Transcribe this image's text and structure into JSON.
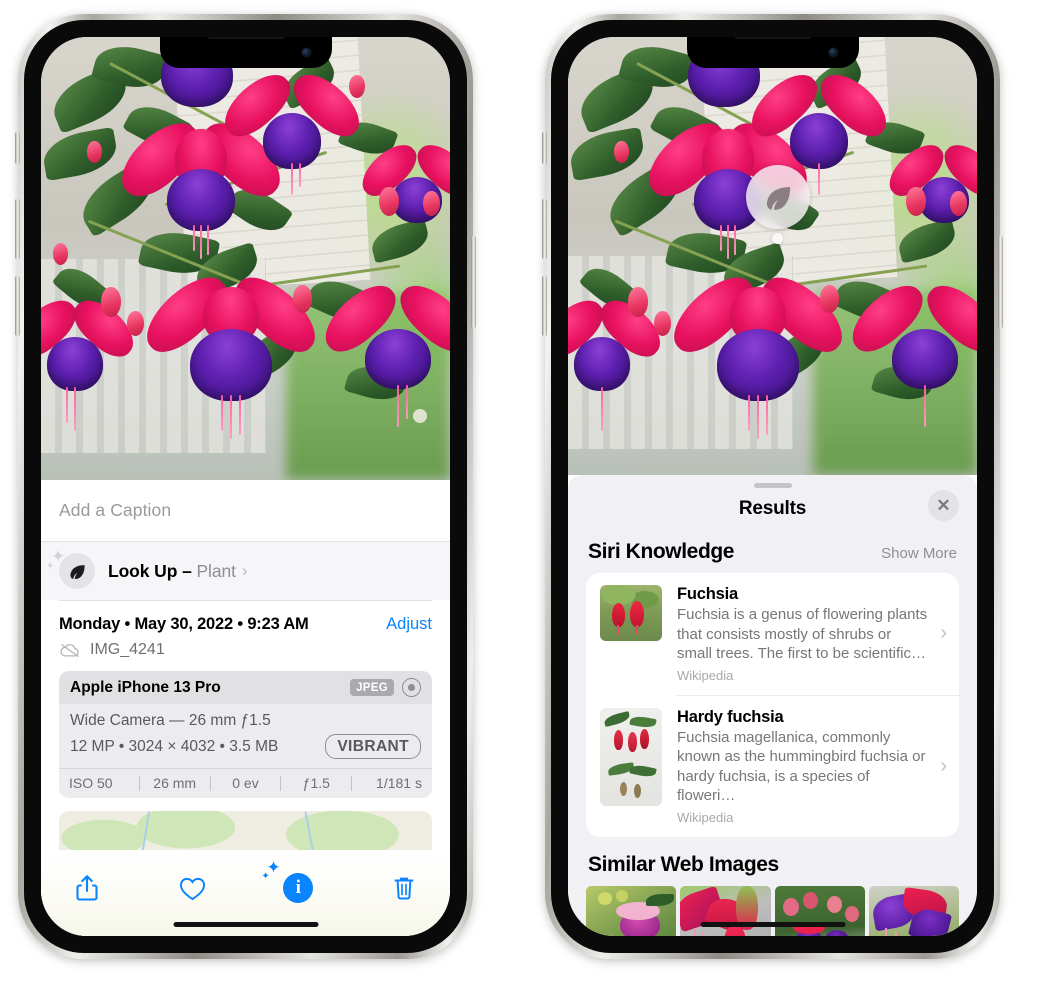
{
  "left_phone": {
    "caption_placeholder": "Add a Caption",
    "lookup": {
      "label": "Look Up",
      "dash": "–",
      "subject": "Plant",
      "chevron": "›",
      "icon": "leaf-icon"
    },
    "meta": {
      "date_line": "Monday • May 30, 2022 • 9:23 AM",
      "adjust_label": "Adjust",
      "file_name": "IMG_4241",
      "cloud_icon": "icloud-slash-icon"
    },
    "exif": {
      "device": "Apple iPhone 13 Pro",
      "format_tag": "JPEG",
      "raw_icon": "raw-target-icon",
      "lens_line": "Wide Camera — 26 mm ƒ1.5",
      "size_line": "12 MP • 3024 × 4032 • 3.5 MB",
      "style_tag": "VIBRANT",
      "stats": [
        "ISO 50",
        "26 mm",
        "0 ev",
        "ƒ1.5",
        "1/181 s"
      ]
    },
    "map": {
      "name": "photo-location-map"
    },
    "toolbar": [
      {
        "name": "share-button",
        "icon": "share-icon"
      },
      {
        "name": "favorite-button",
        "icon": "heart-icon"
      },
      {
        "name": "info-button",
        "icon": "info-sparkle-icon",
        "glyph": "i"
      },
      {
        "name": "delete-button",
        "icon": "trash-icon"
      }
    ]
  },
  "right_phone": {
    "visual_lookup_badge": {
      "name": "leaf-badge",
      "icon": "leaf-icon"
    },
    "sheet": {
      "title": "Results",
      "close_label": "✕",
      "sections": [
        {
          "title": "Siri Knowledge",
          "action": "Show More",
          "items": [
            {
              "title": "Fuchsia",
              "description": "Fuchsia is a genus of flowering plants that consists mostly of shrubs or small trees. The first to be scientific…",
              "source": "Wikipedia",
              "chevron": "›"
            },
            {
              "title": "Hardy fuchsia",
              "description": "Fuchsia magellanica, commonly known as the hummingbird fuchsia or hardy fuchsia, is a species of floweri…",
              "source": "Wikipedia",
              "chevron": "›"
            }
          ]
        },
        {
          "title": "Similar Web Images",
          "items": [
            {
              "name": "web-image-1"
            },
            {
              "name": "web-image-2"
            },
            {
              "name": "web-image-3"
            },
            {
              "name": "web-image-4"
            }
          ]
        }
      ]
    }
  },
  "colors": {
    "accent_blue": "#0a84ff",
    "sheet_bg": "#f1f1f5",
    "card_bg": "#ffffff",
    "secondary_text": "#8e8e93"
  }
}
